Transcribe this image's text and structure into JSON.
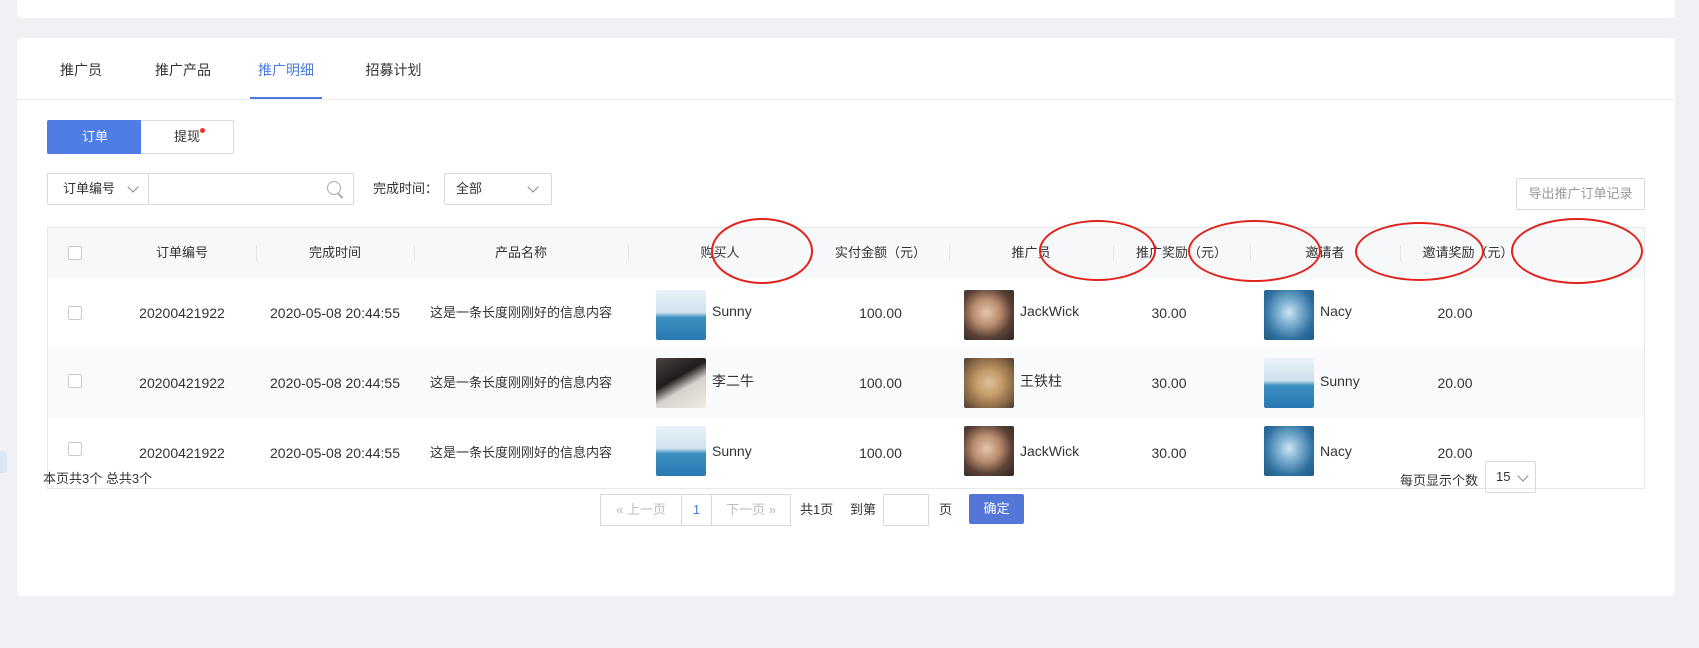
{
  "tabs": [
    {
      "label": "推广员"
    },
    {
      "label": "推广产品"
    },
    {
      "label": "推广明细"
    },
    {
      "label": "招募计划"
    }
  ],
  "active_tab": "推广明细",
  "segments": {
    "order": "订单",
    "withdraw": "提现"
  },
  "filters": {
    "field_select": "订单编号",
    "search_value": "",
    "time_label": "完成时间：",
    "time_select": "全部"
  },
  "export_label": "导出推广订单记录",
  "table": {
    "columns": [
      "订单编号",
      "完成时间",
      "产品名称",
      "购买人",
      "实付金额（元）",
      "推广员",
      "推广奖励（元）",
      "邀请者",
      "邀请奖励（元）"
    ],
    "rows": [
      {
        "order_no": "20200421922",
        "time": "2020-05-08 20:44:55",
        "product": "这是一条长度刚刚好的信息内容",
        "buyer": "Sunny",
        "buyer_avatar": "sea-icon",
        "paid": "100.00",
        "promoter": "JackWick",
        "promoter_avatar": "girl-headphones-icon",
        "promoter_reward": "30.00",
        "inviter": "Nacy",
        "inviter_avatar": "wave-icon",
        "invite_reward": "20.00"
      },
      {
        "order_no": "20200421922",
        "time": "2020-05-08 20:44:55",
        "product": "这是一条长度刚刚好的信息内容",
        "buyer": "李二牛",
        "buyer_avatar": "piano-icon",
        "paid": "100.00",
        "promoter": "王铁柱",
        "promoter_avatar": "cat-icon",
        "promoter_reward": "30.00",
        "inviter": "Sunny",
        "inviter_avatar": "sea-icon",
        "invite_reward": "20.00"
      },
      {
        "order_no": "20200421922",
        "time": "2020-05-08 20:44:55",
        "product": "这是一条长度刚刚好的信息内容",
        "buyer": "Sunny",
        "buyer_avatar": "sea-icon",
        "paid": "100.00",
        "promoter": "JackWick",
        "promoter_avatar": "girl-headphones-icon",
        "promoter_reward": "30.00",
        "inviter": "Nacy",
        "inviter_avatar": "wave-icon",
        "invite_reward": "20.00"
      }
    ]
  },
  "footer": {
    "page_info": "本页共3个  总共3个",
    "per_page_label": "每页显示个数",
    "per_page_value": "15",
    "prev": "上一页",
    "current_page": "1",
    "next": "下一页",
    "total_pages": "共1页",
    "goto_label": "到第",
    "page_unit": "页",
    "confirm": "确定"
  },
  "colors": {
    "accent": "#4f7de3",
    "annotation": "#e0231c"
  }
}
